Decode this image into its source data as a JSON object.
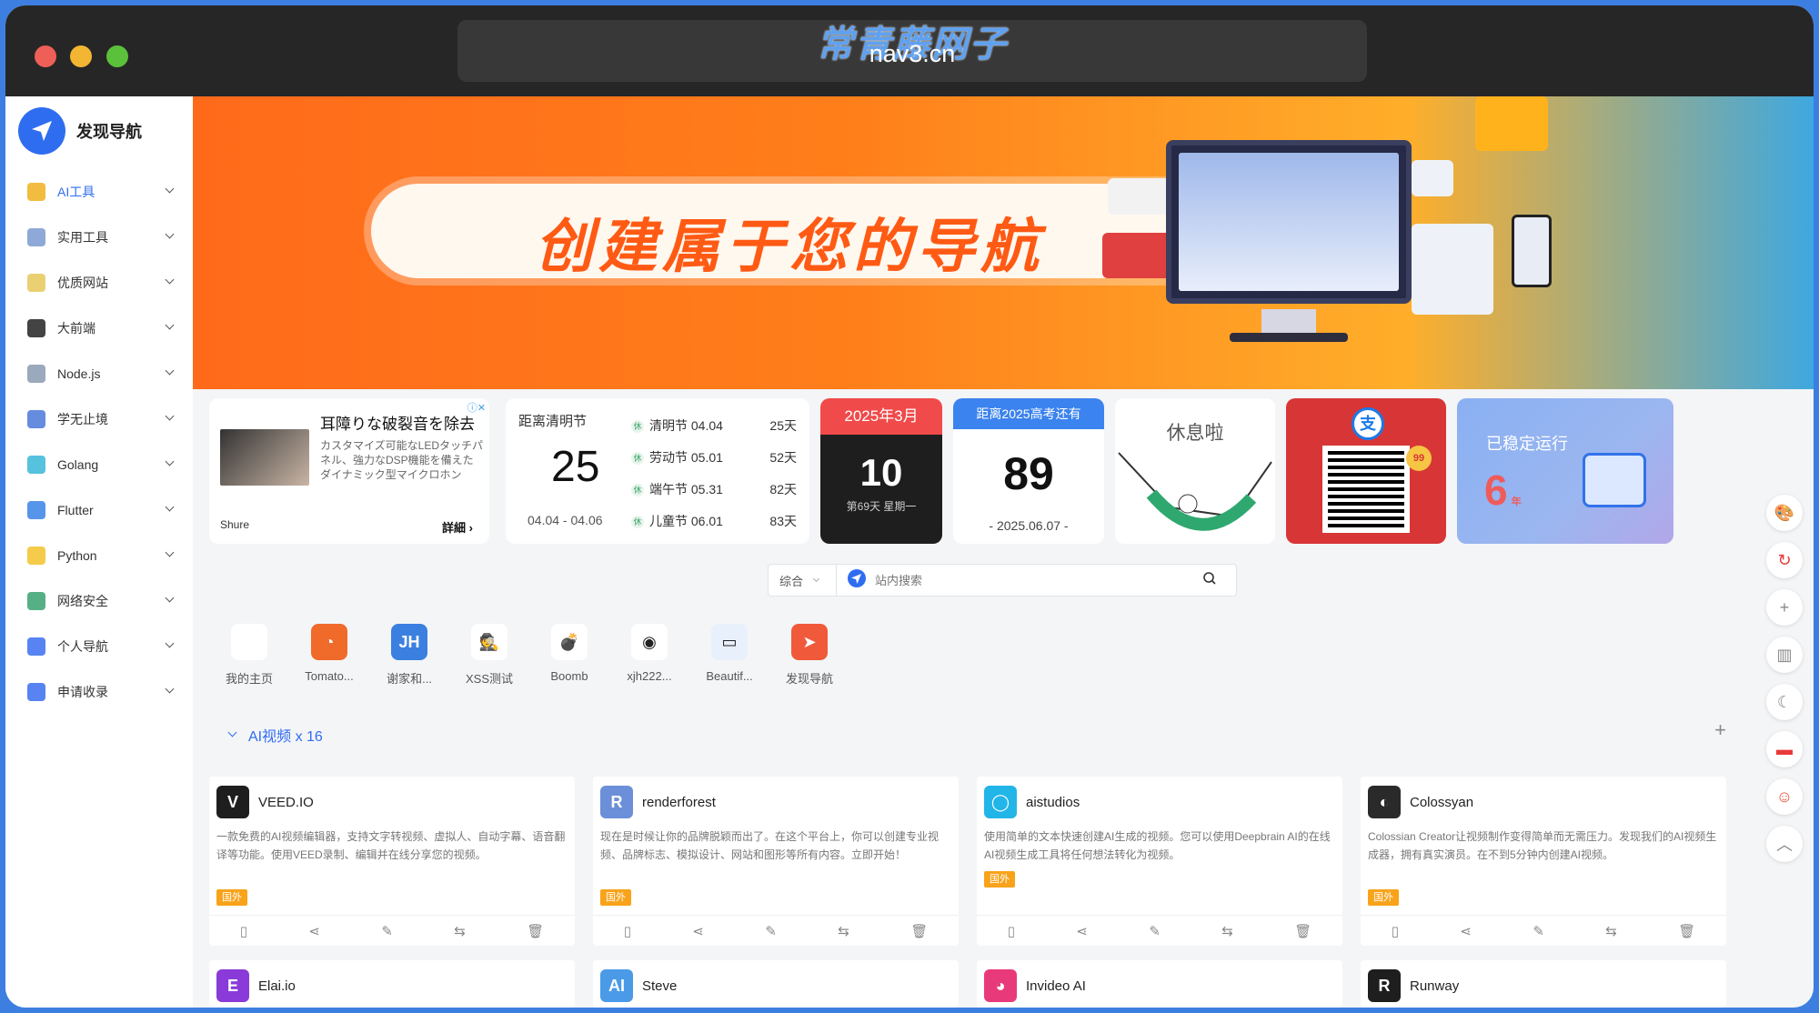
{
  "browser": {
    "url": "nav3.cn",
    "watermark": "常青藤网子"
  },
  "sidebar": {
    "logo_text": "发现导航",
    "items": [
      {
        "label": "AI工具",
        "icon": "ai-icon",
        "color": "#f0b020"
      },
      {
        "label": "实用工具",
        "icon": "tools-icon",
        "color": "#7a9ad0"
      },
      {
        "label": "优质网站",
        "icon": "website-icon",
        "color": "#e8c85a"
      },
      {
        "label": "大前端",
        "icon": "frontend-icon",
        "color": "#222222"
      },
      {
        "label": "Node.js",
        "icon": "nodejs-icon",
        "color": "#8a9ab0"
      },
      {
        "label": "学无止境",
        "icon": "book-icon",
        "color": "#4a78d8"
      },
      {
        "label": "Golang",
        "icon": "golang-icon",
        "color": "#38b7d8"
      },
      {
        "label": "Flutter",
        "icon": "flutter-icon",
        "color": "#3a82e8"
      },
      {
        "label": "Python",
        "icon": "python-icon",
        "color": "#f2c22a"
      },
      {
        "label": "网络安全",
        "icon": "security-icon",
        "color": "#3aa270"
      },
      {
        "label": "个人导航",
        "icon": "compass-icon",
        "color": "#3a6ef0"
      },
      {
        "label": "申请收录",
        "icon": "apps-icon",
        "color": "#3a6ef0"
      }
    ]
  },
  "banner": {
    "title": "创建属于您的导航"
  },
  "ad": {
    "title": "耳障りな破裂音を除去",
    "desc": "カスタマイズ可能なLEDタッチパネル、強力なDSP機能を備えたダイナミック型マイクロホン",
    "brand": "Shure",
    "more": "詳細 ›",
    "badge": "ⓘ✕"
  },
  "holiday": {
    "title": "距离清明节",
    "days": "25",
    "range": "04.04 - 04.06",
    "list": [
      {
        "name": "清明节 04.04",
        "days": "25天"
      },
      {
        "name": "劳动节 05.01",
        "days": "52天"
      },
      {
        "name": "端午节 05.31",
        "days": "82天"
      },
      {
        "name": "儿童节 06.01",
        "days": "83天"
      }
    ]
  },
  "calendar": {
    "month": "2025年3月",
    "day": "10",
    "sub": "第69天 星期一"
  },
  "exam": {
    "title": "距离2025高考还有",
    "days": "89",
    "date": "- 2025.06.07 -"
  },
  "rest": {
    "title": "休息啦"
  },
  "pay": {
    "icon_text": "支",
    "badge": "99"
  },
  "uptime": {
    "title": "已稳定运行",
    "num": "6",
    "unit": "年"
  },
  "search": {
    "category": "综合",
    "placeholder": "站内搜索"
  },
  "quick_links": [
    {
      "label": "我的主页",
      "icon": "dots-icon",
      "color": "#ffffff",
      "text": ""
    },
    {
      "label": "Tomato...",
      "icon": "tomato-icon",
      "color": "#f06a2a",
      "text": "◔"
    },
    {
      "label": "谢家和...",
      "icon": "jh-icon",
      "color": "#3b7fe0",
      "text": "JH"
    },
    {
      "label": "XSS测试",
      "icon": "spy-icon",
      "color": "#ffffff",
      "text": "🕵"
    },
    {
      "label": "Boomb",
      "icon": "bomb-icon",
      "color": "#ffffff",
      "text": "💣"
    },
    {
      "label": "xjh222...",
      "icon": "github-icon",
      "color": "#ffffff",
      "text": "◉"
    },
    {
      "label": "Beautif...",
      "icon": "window-icon",
      "color": "#e8f0fb",
      "text": "▭"
    },
    {
      "label": "发现导航",
      "icon": "navigate-icon",
      "color": "#f05a3a",
      "text": "➤"
    }
  ],
  "section": {
    "title": "AI视频 x 16",
    "plus": "+"
  },
  "sites": [
    {
      "name": "VEED.IO",
      "icon_text": "V",
      "color": "#1e1e1e",
      "desc": "一款免费的AI视频编辑器，支持文字转视频、虚拟人、自动字幕、语音翻译等功能。使用VEED录制、编辑并在线分享您的视频。",
      "tag": "国外"
    },
    {
      "name": "renderforest",
      "icon_text": "R",
      "color": "#6b8fd8",
      "desc": "现在是时候让你的品牌脱颖而出了。在这个平台上，你可以创建专业视频、品牌标志、模拟设计、网站和图形等所有内容。立即开始！",
      "tag": "国外"
    },
    {
      "name": "aistudios",
      "icon_text": "◯",
      "color": "#22b5e8",
      "desc": "使用简单的文本快速创建AI生成的视频。您可以使用Deepbrain AI的在线AI视频生成工具将任何想法转化为视频。",
      "tag": "国外"
    },
    {
      "name": "Colossyan",
      "icon_text": "◐",
      "color": "#2a2a2a",
      "desc": "Colossian Creator让视频制作变得简单而无需压力。发现我们的AI视频生成器，拥有真实演员。在不到5分钟内创建AI视频。",
      "tag": "国外"
    },
    {
      "name": "Elai.io",
      "icon_text": "E",
      "color": "#8a3ad8",
      "desc": "",
      "tag": ""
    },
    {
      "name": "Steve",
      "icon_text": "AI",
      "color": "#4a9ae8",
      "desc": "",
      "tag": ""
    },
    {
      "name": "Invideo AI",
      "icon_text": "◕",
      "color": "#e83a7a",
      "desc": "",
      "tag": ""
    },
    {
      "name": "Runway",
      "icon_text": "R",
      "color": "#1e1e1e",
      "desc": "",
      "tag": ""
    }
  ],
  "site_actions": [
    "▯",
    "⋖",
    "✎",
    "⇆",
    "🗑"
  ],
  "right_rail": [
    {
      "icon": "palette-icon",
      "text": "🎨"
    },
    {
      "icon": "refresh-icon",
      "text": "↻"
    },
    {
      "icon": "plus-icon",
      "text": "+"
    },
    {
      "icon": "columns-icon",
      "text": "▥"
    },
    {
      "icon": "moon-icon",
      "text": "☾"
    },
    {
      "icon": "flag-icon",
      "text": "▬"
    },
    {
      "icon": "smile-icon",
      "text": "☺"
    },
    {
      "icon": "up-icon",
      "text": "︿"
    }
  ]
}
